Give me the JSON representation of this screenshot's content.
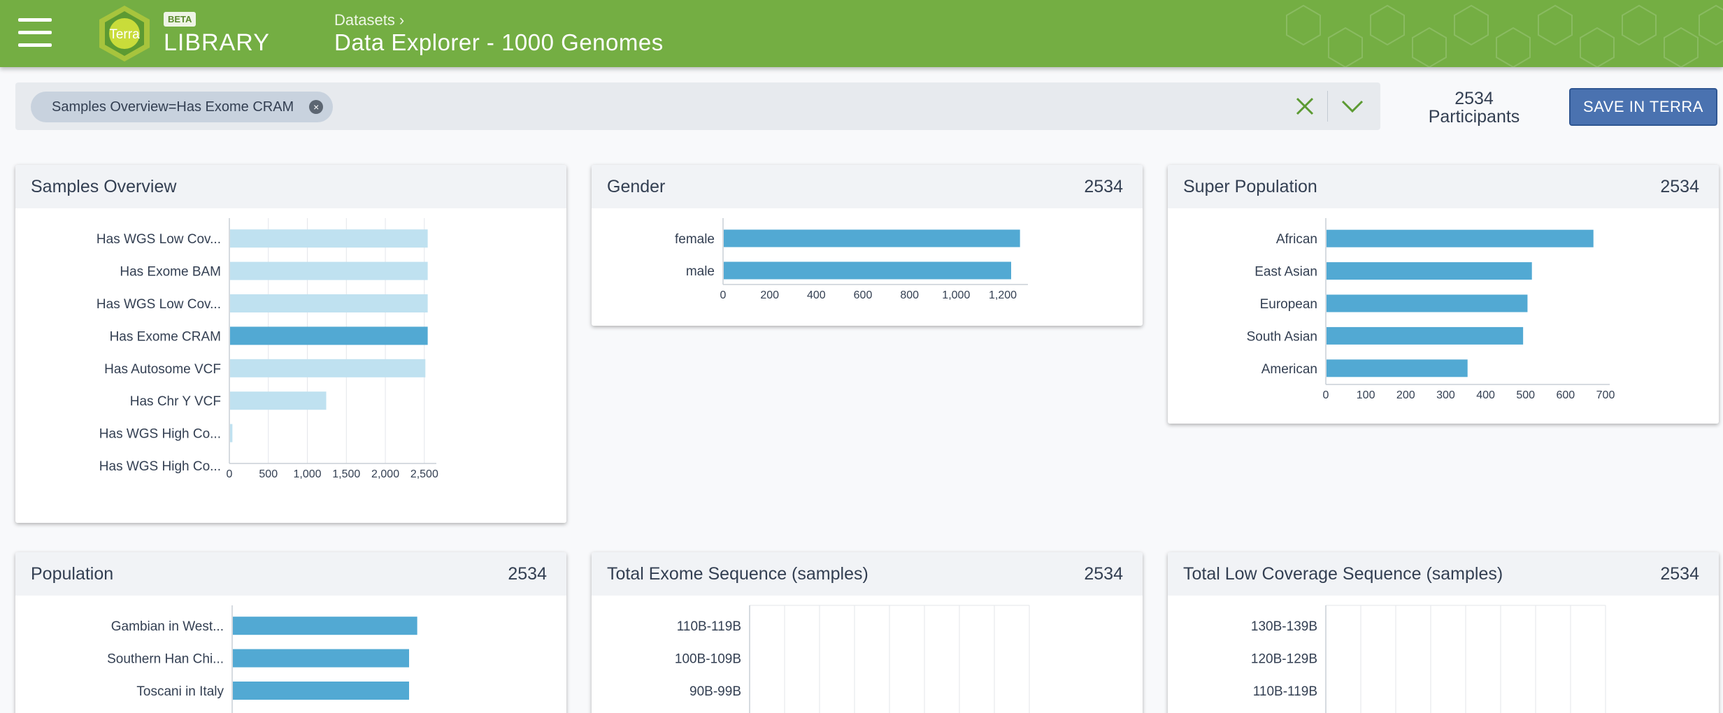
{
  "header": {
    "logo_text": "Terra",
    "beta_badge": "BETA",
    "library_label": "LIBRARY",
    "breadcrumb": "Datasets ›",
    "page_title": "Data Explorer - 1000 Genomes"
  },
  "filter": {
    "chip_label": "Samples Overview=Has Exome CRAM",
    "chip_remove": "×"
  },
  "summary": {
    "count": "2534",
    "label": "Participants"
  },
  "save_button": "SAVE IN TERRA",
  "colors": {
    "header": "#74ae43",
    "bar": "#52a9d3",
    "bar_light": "#bfe1f0",
    "save": "#4a72b0"
  },
  "cards": [
    {
      "title": "Samples Overview",
      "count": "",
      "chart_data": {
        "type": "bar",
        "orientation": "horizontal",
        "categories": [
          "Has WGS Low Cov...",
          "Has Exome BAM",
          "Has WGS Low Cov...",
          "Has Exome CRAM",
          "Has Autosome VCF",
          "Has Chr Y VCF",
          "Has WGS High Co...",
          "Has WGS High Co..."
        ],
        "values": [
          2534,
          2534,
          2534,
          2534,
          2504,
          1233,
          30,
          0
        ],
        "highlighted": [
          false,
          false,
          false,
          true,
          false,
          false,
          false,
          false
        ],
        "ticks": [
          "0",
          "500",
          "1,000",
          "1,500",
          "2,000",
          "2,500"
        ],
        "tick_values": [
          0,
          500,
          1000,
          1500,
          2000,
          2500
        ],
        "xlim": [
          0,
          2600
        ],
        "grid": true
      }
    },
    {
      "title": "Gender",
      "count": "2534",
      "chart_data": {
        "type": "bar",
        "orientation": "horizontal",
        "categories": [
          "female",
          "male"
        ],
        "values": [
          1271,
          1233
        ],
        "ticks": [
          "0",
          "200",
          "400",
          "600",
          "800",
          "1,000",
          "1,200"
        ],
        "tick_values": [
          0,
          200,
          400,
          600,
          800,
          1000,
          1200
        ],
        "xlim": [
          0,
          1290
        ],
        "grid": false
      }
    },
    {
      "title": "Super Population",
      "count": "2534",
      "chart_data": {
        "type": "bar",
        "orientation": "horizontal",
        "categories": [
          "African",
          "East Asian",
          "European",
          "South Asian",
          "American"
        ],
        "values": [
          668,
          514,
          503,
          492,
          353
        ],
        "ticks": [
          "0",
          "100",
          "200",
          "300",
          "400",
          "500",
          "600",
          "700"
        ],
        "tick_values": [
          0,
          100,
          200,
          300,
          400,
          500,
          600,
          700
        ],
        "xlim": [
          0,
          700
        ],
        "grid": false
      }
    },
    {
      "title": "Population",
      "count": "2534",
      "chart_data": {
        "type": "bar",
        "orientation": "horizontal",
        "categories": [
          "Gambian in West...",
          "Southern Han Chi...",
          "Toscani in Italy"
        ],
        "values": [
          113,
          108,
          108
        ],
        "xlim": [
          0,
          120
        ],
        "grid": false
      }
    },
    {
      "title": "Total Exome Sequence (samples)",
      "count": "2534",
      "chart_data": {
        "type": "bar",
        "orientation": "horizontal",
        "categories": [
          "110B-119B",
          "100B-109B",
          "90B-99B"
        ],
        "values": [
          0,
          0,
          0
        ],
        "grid": true
      }
    },
    {
      "title": "Total Low Coverage Sequence (samples)",
      "count": "2534",
      "chart_data": {
        "type": "bar",
        "orientation": "horizontal",
        "categories": [
          "130B-139B",
          "120B-129B",
          "110B-119B"
        ],
        "values": [
          0,
          0,
          0
        ],
        "grid": true
      }
    }
  ]
}
